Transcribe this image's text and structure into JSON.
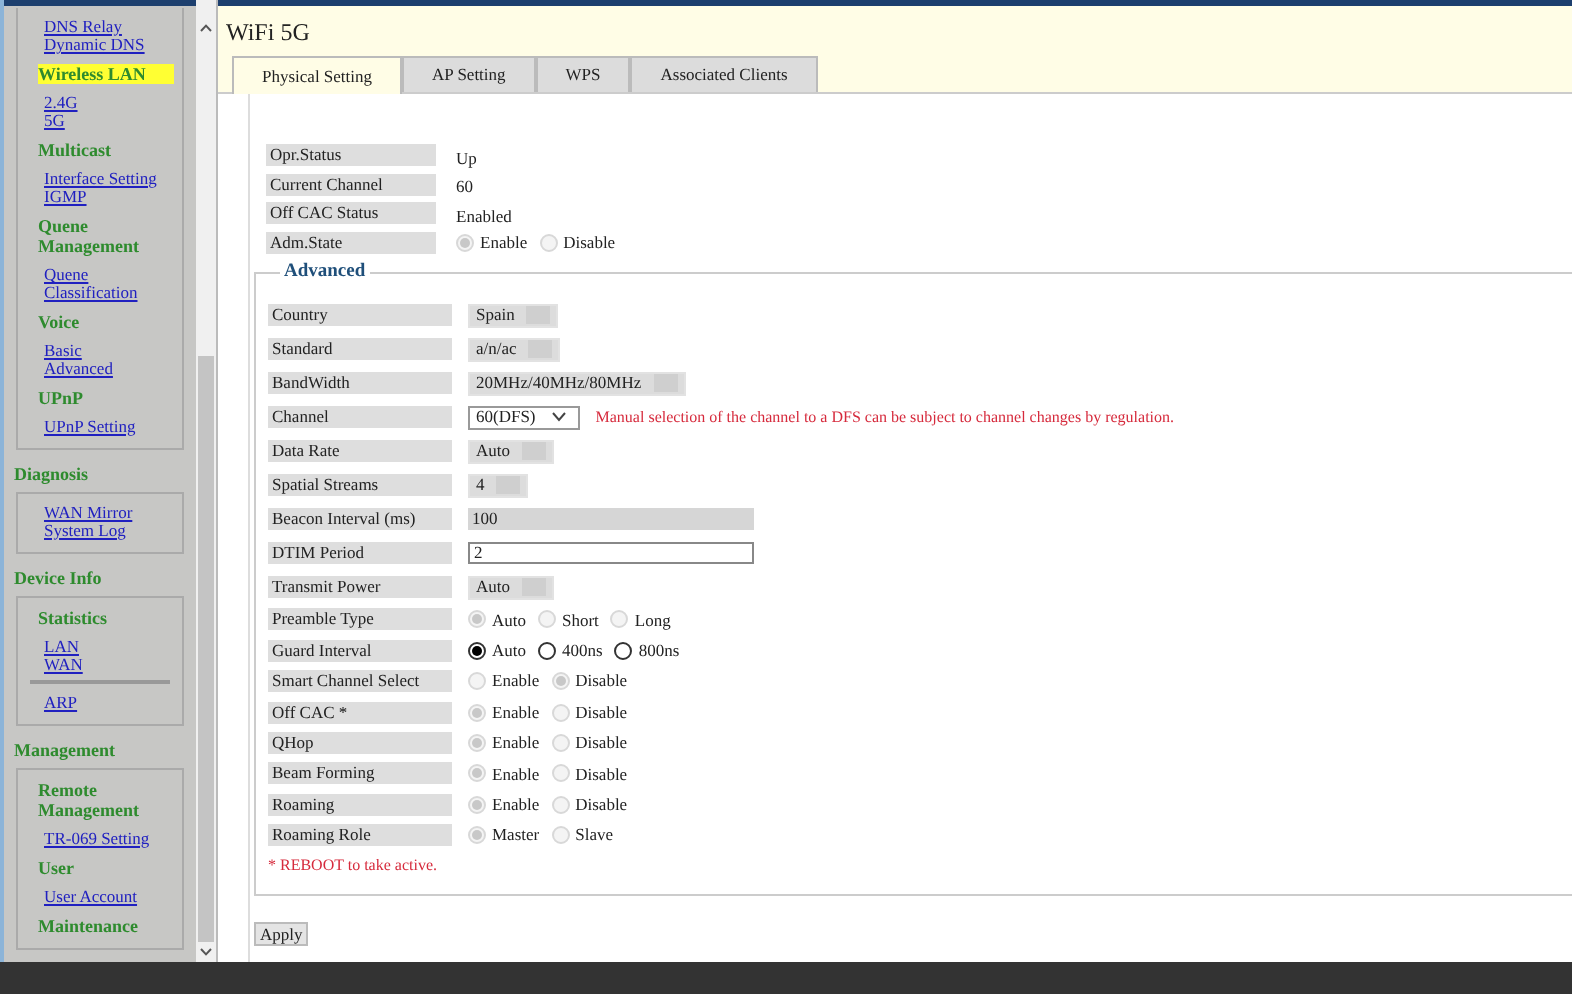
{
  "sidebar": {
    "blocks": [
      {
        "kind": "box",
        "items": [
          {
            "kind": "links",
            "labels": [
              "DNS Relay",
              "Dynamic DNS"
            ]
          },
          {
            "kind": "heading",
            "label": "Wireless LAN",
            "selected": true
          },
          {
            "kind": "links",
            "labels": [
              "2.4G",
              "5G"
            ]
          },
          {
            "kind": "heading",
            "label": "Multicast",
            "selected": false
          },
          {
            "kind": "links",
            "labels": [
              "Interface Setting",
              "IGMP"
            ]
          },
          {
            "kind": "heading",
            "label": "Quene Management",
            "selected": false
          },
          {
            "kind": "links",
            "labels": [
              "Quene",
              "Classification"
            ]
          },
          {
            "kind": "heading",
            "label": "Voice",
            "selected": false
          },
          {
            "kind": "links",
            "labels": [
              "Basic",
              "Advanced"
            ]
          },
          {
            "kind": "heading",
            "label": "UPnP",
            "selected": false
          },
          {
            "kind": "links",
            "labels": [
              "UPnP Setting"
            ]
          }
        ]
      },
      {
        "kind": "heading",
        "label": "Diagnosis"
      },
      {
        "kind": "box",
        "items": [
          {
            "kind": "links",
            "labels": [
              "WAN Mirror",
              "System Log"
            ]
          }
        ]
      },
      {
        "kind": "heading",
        "label": "Device Info"
      },
      {
        "kind": "box",
        "items": [
          {
            "kind": "heading",
            "label": "Statistics",
            "selected": false
          },
          {
            "kind": "links",
            "labels": [
              "LAN",
              "WAN"
            ]
          },
          {
            "kind": "rule"
          },
          {
            "kind": "links",
            "labels": [
              "ARP"
            ]
          }
        ]
      },
      {
        "kind": "heading",
        "label": "Management"
      },
      {
        "kind": "box",
        "items": [
          {
            "kind": "heading",
            "label": "Remote Management",
            "selected": false
          },
          {
            "kind": "links",
            "labels": [
              "TR-069 Setting"
            ]
          },
          {
            "kind": "heading",
            "label": "User",
            "selected": false
          },
          {
            "kind": "links",
            "labels": [
              "User Account"
            ]
          },
          {
            "kind": "heading",
            "label": "Maintenance",
            "selected": false
          }
        ]
      }
    ]
  },
  "page": {
    "title": "WiFi 5G"
  },
  "tabs": [
    {
      "label": "Physical Setting",
      "selected": true
    },
    {
      "label": "AP Setting",
      "selected": false
    },
    {
      "label": "WPS",
      "selected": false
    },
    {
      "label": "Associated Clients",
      "selected": false
    }
  ],
  "status": [
    {
      "kind": "text",
      "label": "Opr.Status",
      "value": "Up"
    },
    {
      "kind": "text",
      "label": "Current Channel",
      "value": "60"
    },
    {
      "kind": "text",
      "label": "Off CAC Status",
      "value": "Enabled"
    },
    {
      "kind": "radio",
      "label": "Adm.State",
      "disabled": true,
      "options": [
        {
          "label": "Enable",
          "selected": true
        },
        {
          "label": "Disable",
          "selected": false
        }
      ]
    }
  ],
  "advanced": {
    "legend": "Advanced",
    "rows": [
      {
        "kind": "select",
        "label": "Country",
        "value": "Spain",
        "disabled": true
      },
      {
        "kind": "select",
        "label": "Standard",
        "value": "a/n/ac",
        "disabled": true
      },
      {
        "kind": "select",
        "label": "BandWidth",
        "value": "20MHz/40MHz/80MHz",
        "disabled": true
      },
      {
        "kind": "select",
        "label": "Channel",
        "value": "60(DFS)",
        "disabled": false,
        "note": "Manual selection of the channel to a DFS can be subject to channel changes by regulation."
      },
      {
        "kind": "select",
        "label": "Data Rate",
        "value": "Auto",
        "disabled": true
      },
      {
        "kind": "select",
        "label": "Spatial Streams",
        "value": "4",
        "disabled": true
      },
      {
        "kind": "input",
        "label": "Beacon Interval (ms)",
        "value": "100",
        "disabled": true
      },
      {
        "kind": "input",
        "label": "DTIM Period",
        "value": "2",
        "disabled": false
      },
      {
        "kind": "select",
        "label": "Transmit Power",
        "value": "Auto",
        "disabled": true
      },
      {
        "kind": "radio",
        "label": "Preamble Type",
        "disabled": true,
        "options": [
          {
            "label": "Auto",
            "selected": true
          },
          {
            "label": "Short",
            "selected": false
          },
          {
            "label": "Long",
            "selected": false
          }
        ]
      },
      {
        "kind": "radio",
        "label": "Guard Interval",
        "disabled": false,
        "options": [
          {
            "label": "Auto",
            "selected": true
          },
          {
            "label": "400ns",
            "selected": false
          },
          {
            "label": "800ns",
            "selected": false
          }
        ]
      },
      {
        "kind": "radio",
        "label": "Smart Channel Select",
        "disabled": true,
        "options": [
          {
            "label": "Enable",
            "selected": false
          },
          {
            "label": "Disable",
            "selected": true
          }
        ]
      },
      {
        "kind": "radio",
        "label": "Off CAC *",
        "disabled": true,
        "options": [
          {
            "label": "Enable",
            "selected": true
          },
          {
            "label": "Disable",
            "selected": false
          }
        ]
      },
      {
        "kind": "radio",
        "label": "QHop",
        "disabled": true,
        "options": [
          {
            "label": "Enable",
            "selected": true
          },
          {
            "label": "Disable",
            "selected": false
          }
        ]
      },
      {
        "kind": "radio",
        "label": "Beam Forming",
        "disabled": true,
        "options": [
          {
            "label": "Enable",
            "selected": true
          },
          {
            "label": "Disable",
            "selected": false
          }
        ]
      },
      {
        "kind": "radio",
        "label": "Roaming",
        "disabled": true,
        "options": [
          {
            "label": "Enable",
            "selected": true
          },
          {
            "label": "Disable",
            "selected": false
          }
        ]
      },
      {
        "kind": "radio",
        "label": "Roaming Role",
        "disabled": true,
        "options": [
          {
            "label": "Master",
            "selected": true
          },
          {
            "label": "Slave",
            "selected": false
          }
        ]
      }
    ],
    "footnote": "* REBOOT to take active."
  },
  "apply_button": "Apply"
}
